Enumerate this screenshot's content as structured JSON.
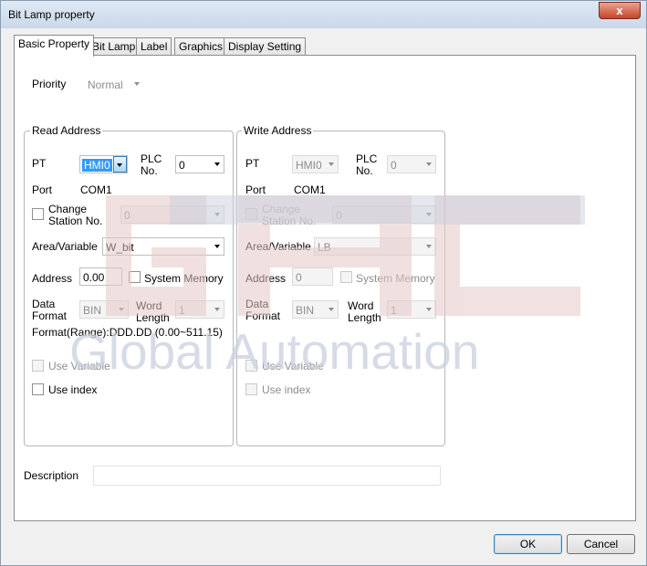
{
  "window": {
    "title": "Bit Lamp property",
    "close_symbol": "x"
  },
  "tabs": [
    {
      "label": "Basic Property",
      "active": true
    },
    {
      "label": "Bit Lamp",
      "active": false
    },
    {
      "label": "Label",
      "active": false
    },
    {
      "label": "Graphics",
      "active": false
    },
    {
      "label": "Display Setting",
      "active": false
    }
  ],
  "priority": {
    "label": "Priority",
    "value": "Normal"
  },
  "read_address": {
    "group_title": "Read Address",
    "pt_label": "PT",
    "pt_value": "HMI0",
    "plc_no_label_1": "PLC",
    "plc_no_label_2": "No.",
    "plc_no_value": "0",
    "port_label": "Port",
    "port_value": "COM1",
    "change_station_label_1": "Change",
    "change_station_label_2": "Station No.",
    "change_station_value": "0",
    "area_variable_label": "Area/Variable",
    "area_variable_value": "W_bit",
    "address_label": "Address",
    "address_value": "0.00",
    "system_memory_label": "System Memory",
    "data_format_label_1": "Data",
    "data_format_label_2": "Format",
    "data_format_value": "BIN",
    "word_length_label_1": "Word",
    "word_length_label_2": "Length",
    "word_length_value": "1",
    "format_range": "Format(Range):DDD.DD (0.00~511.15)",
    "use_variable_label": "Use Variable",
    "use_index_label": "Use index"
  },
  "write_address": {
    "group_title": "Write Address",
    "pt_label": "PT",
    "pt_value": "HMI0",
    "plc_no_label_1": "PLC",
    "plc_no_label_2": "No.",
    "plc_no_value": "0",
    "port_label": "Port",
    "port_value": "COM1",
    "change_station_label_1": "Change",
    "change_station_label_2": "Station No.",
    "change_station_value": "0",
    "area_variable_label": "Area/Variable",
    "area_variable_value": "LB",
    "address_label": "Address",
    "address_value": "0",
    "system_memory_label": "System Memory",
    "data_format_label_1": "Data",
    "data_format_label_2": "Format",
    "data_format_value": "BIN",
    "word_length_label_1": "Word",
    "word_length_label_2": "Length",
    "word_length_value": "1",
    "use_variable_label": "Use Variable",
    "use_index_label": "Use index"
  },
  "description": {
    "label": "Description",
    "value": ""
  },
  "buttons": {
    "ok": "OK",
    "cancel": "Cancel"
  },
  "watermark": {
    "logo_text": "GAC",
    "tagline": "Global Automation"
  },
  "colors": {
    "watermark_red": "#e8c3c3",
    "watermark_blue": "#c8cfdd",
    "selection": "#3399ff"
  }
}
